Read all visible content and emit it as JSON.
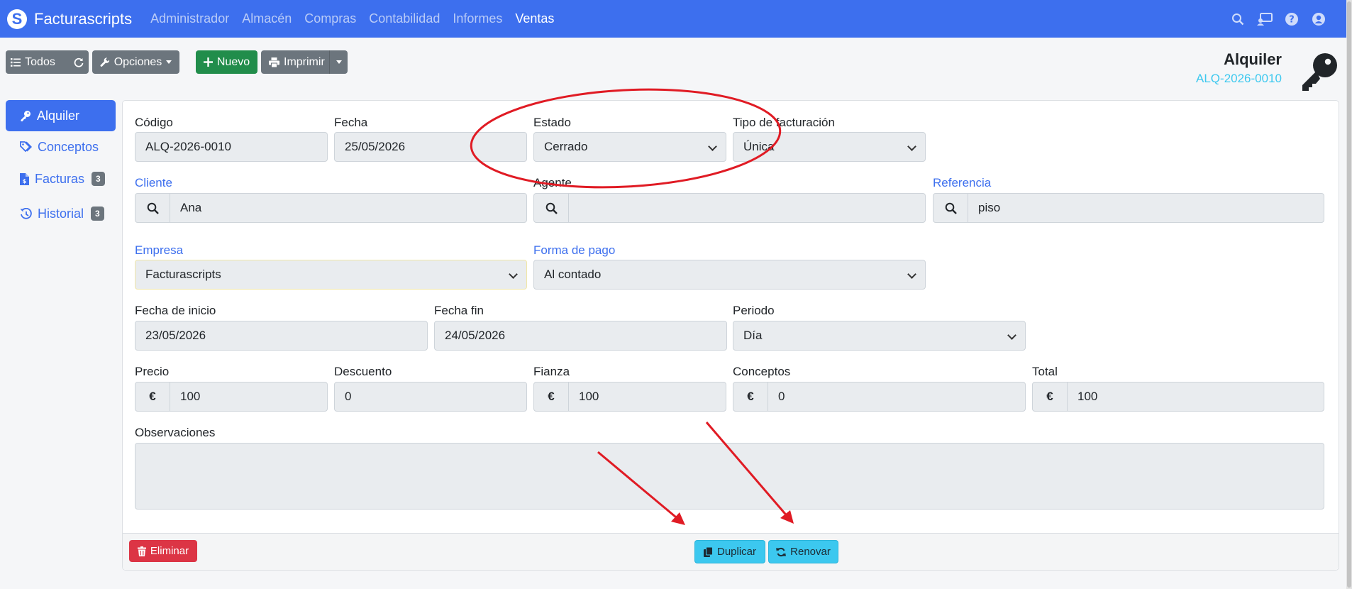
{
  "navbar": {
    "brand": "Facturascripts",
    "menu": [
      "Administrador",
      "Almacén",
      "Compras",
      "Contabilidad",
      "Informes",
      "Ventas"
    ],
    "active_index": 5,
    "icons": [
      "search-icon",
      "chat-icon",
      "help-icon",
      "user-icon"
    ]
  },
  "toolbar": {
    "all_label": "Todos",
    "options_label": "Opciones",
    "new_label": "Nuevo",
    "print_label": "Imprimir"
  },
  "header": {
    "title": "Alquiler",
    "code": "ALQ-2026-0010"
  },
  "sidebar": {
    "items": [
      {
        "label": "Alquiler",
        "icon": "key-icon",
        "badge": ""
      },
      {
        "label": "Conceptos",
        "icon": "tags-icon",
        "badge": ""
      },
      {
        "label": "Facturas",
        "icon": "file-invoice-icon",
        "badge": "3"
      },
      {
        "label": "Historial",
        "icon": "history-icon",
        "badge": "3"
      }
    ]
  },
  "form": {
    "codigo": {
      "label": "Código",
      "value": "ALQ-2026-0010"
    },
    "fecha": {
      "label": "Fecha",
      "value": "25/05/2026"
    },
    "estado": {
      "label": "Estado",
      "value": "Cerrado"
    },
    "tipo_facturacion": {
      "label": "Tipo de facturación",
      "value": "Única"
    },
    "cliente": {
      "label": "Cliente",
      "value": "Ana"
    },
    "agente": {
      "label": "Agente",
      "value": ""
    },
    "referencia": {
      "label": "Referencia",
      "value": "piso"
    },
    "empresa": {
      "label": "Empresa",
      "value": "Facturascripts"
    },
    "forma_pago": {
      "label": "Forma de pago",
      "value": "Al contado"
    },
    "fecha_inicio": {
      "label": "Fecha de inicio",
      "value": "23/05/2026"
    },
    "fecha_fin": {
      "label": "Fecha fin",
      "value": "24/05/2026"
    },
    "periodo": {
      "label": "Periodo",
      "value": "Día"
    },
    "precio": {
      "label": "Precio",
      "value": "100"
    },
    "descuento": {
      "label": "Descuento",
      "value": "0"
    },
    "fianza": {
      "label": "Fianza",
      "value": "100"
    },
    "conceptos": {
      "label": "Conceptos",
      "value": "0"
    },
    "total": {
      "label": "Total",
      "value": "100"
    },
    "observaciones": {
      "label": "Observaciones",
      "value": ""
    },
    "currency_symbol": "€"
  },
  "footer": {
    "delete_label": "Eliminar",
    "duplicate_label": "Duplicar",
    "renew_label": "Renovar"
  },
  "annotation_colors": {
    "red": "#e01b24"
  }
}
